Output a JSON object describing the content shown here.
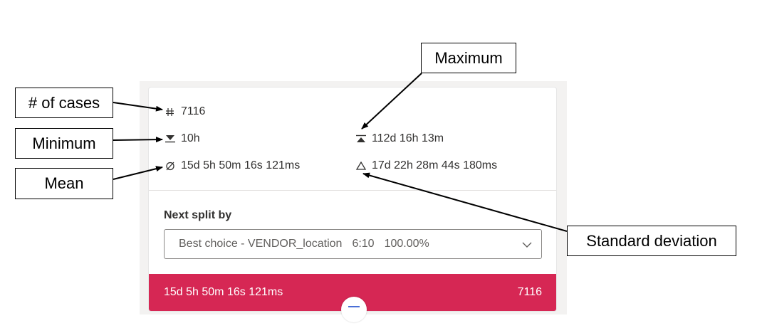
{
  "stats": {
    "cases_value": "7116",
    "min_value": "10h",
    "max_value": "112d 16h 13m",
    "mean_value": "15d 5h 50m 16s 121ms",
    "stddev_value": "17d 22h 28m 44s 180ms"
  },
  "split": {
    "label": "Next split by",
    "choice": "Best choice - VENDOR_location",
    "ratio": "6:10",
    "percent": "100.00%"
  },
  "bar": {
    "mean": "15d 5h 50m 16s 121ms",
    "count": "7116",
    "color": "#d62754"
  },
  "callouts": {
    "cases": "# of cases",
    "minimum": "Minimum",
    "mean": "Mean",
    "maximum": "Maximum",
    "stddev": "Standard deviation"
  },
  "icons": {
    "cases": "hash-icon",
    "minimum": "minimum-icon",
    "maximum": "maximum-icon",
    "mean": "mean-icon",
    "stddev": "triangle-icon",
    "dropdown": "chevron-down-icon"
  }
}
